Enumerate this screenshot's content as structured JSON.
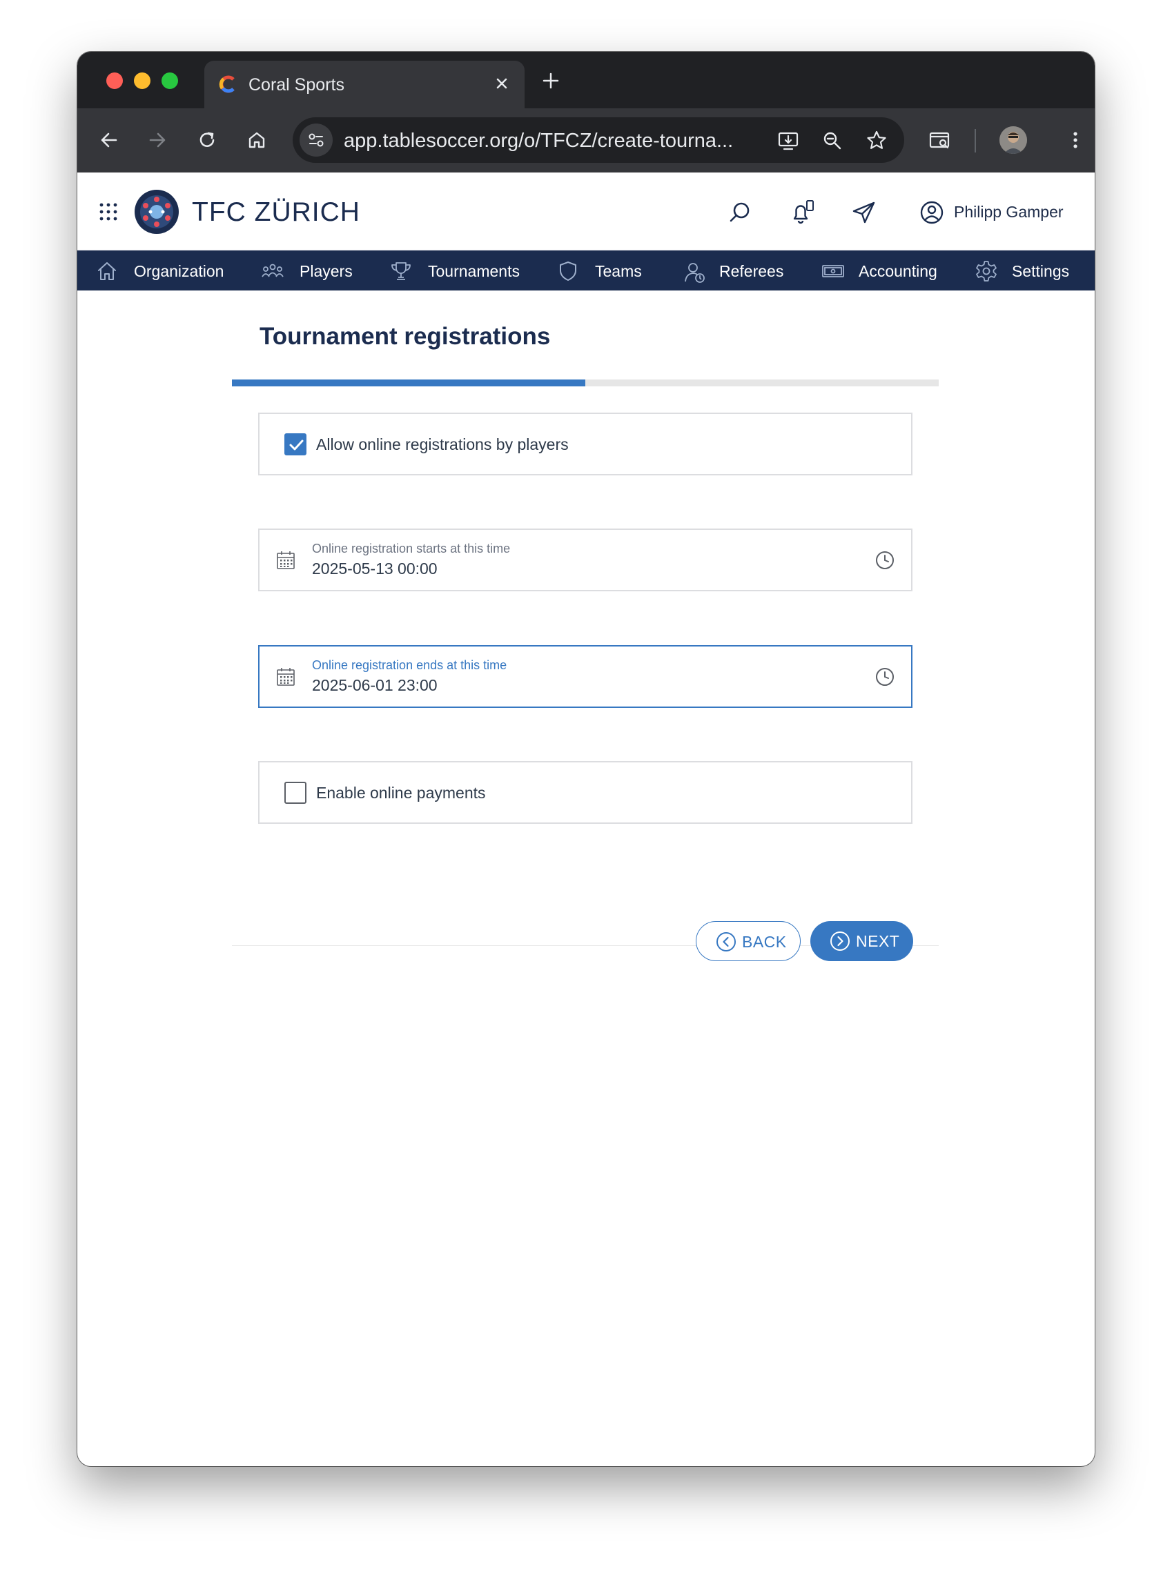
{
  "browser": {
    "tab_title": "Coral Sports",
    "url": "app.tablesoccer.org/o/TFCZ/create-tourna..."
  },
  "header": {
    "org_name": "TFC ZÜRICH",
    "user_name": "Philipp Gamper"
  },
  "nav": {
    "items": [
      {
        "label": "Organization",
        "icon": "home-icon"
      },
      {
        "label": "Players",
        "icon": "players-icon"
      },
      {
        "label": "Tournaments",
        "icon": "trophy-icon"
      },
      {
        "label": "Teams",
        "icon": "shield-icon"
      },
      {
        "label": "Referees",
        "icon": "referee-icon"
      },
      {
        "label": "Accounting",
        "icon": "money-icon"
      },
      {
        "label": "Settings",
        "icon": "gear-icon"
      }
    ]
  },
  "main": {
    "title": "Tournament registrations",
    "progress": 0.5,
    "allow_online_registrations": {
      "label": "Allow online registrations by players",
      "checked": true
    },
    "registration_start": {
      "label": "Online registration starts at this time",
      "value": "2025-05-13 00:00"
    },
    "registration_end": {
      "label": "Online registration ends at this time",
      "value": "2025-06-01 23:00"
    },
    "enable_online_payments": {
      "label": "Enable online payments",
      "checked": false
    },
    "back_label": "BACK",
    "next_label": "NEXT"
  },
  "colors": {
    "primary": "#3778c2",
    "navy": "#1b2c4f",
    "browser_dark": "#202124",
    "browser_toolbar": "#35363a"
  }
}
